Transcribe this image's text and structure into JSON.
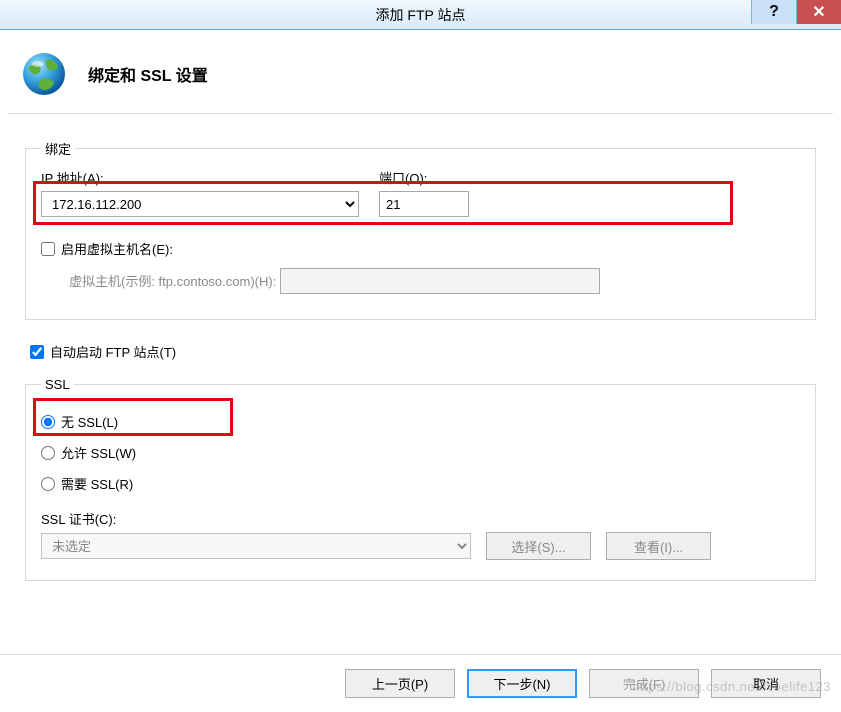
{
  "window": {
    "title": "添加 FTP 站点"
  },
  "header": {
    "title": "绑定和 SSL 设置"
  },
  "binding": {
    "legend": "绑定",
    "ip_label": "IP 地址(A):",
    "ip_value": "172.16.112.200",
    "port_label": "端口(O):",
    "port_value": "21",
    "enable_vhost_label": "启用虚拟主机名(E):",
    "enable_vhost_checked": false,
    "vhost_label": "虚拟主机(示例: ftp.contoso.com)(H):",
    "vhost_value": ""
  },
  "auto_start": {
    "label": "自动启动 FTP 站点(T)",
    "checked": true
  },
  "ssl": {
    "legend": "SSL",
    "no_ssl_label": "无 SSL(L)",
    "allow_ssl_label": "允许 SSL(W)",
    "require_ssl_label": "需要 SSL(R)",
    "selected": "none",
    "cert_label": "SSL 证书(C):",
    "cert_value": "未选定",
    "select_btn": "选择(S)...",
    "view_btn": "查看(I)..."
  },
  "footer": {
    "prev": "上一页(P)",
    "next": "下一步(N)",
    "finish": "完成(F)",
    "cancel": "取消"
  },
  "watermark": "https://blog.csdn.net/lvoelife123"
}
